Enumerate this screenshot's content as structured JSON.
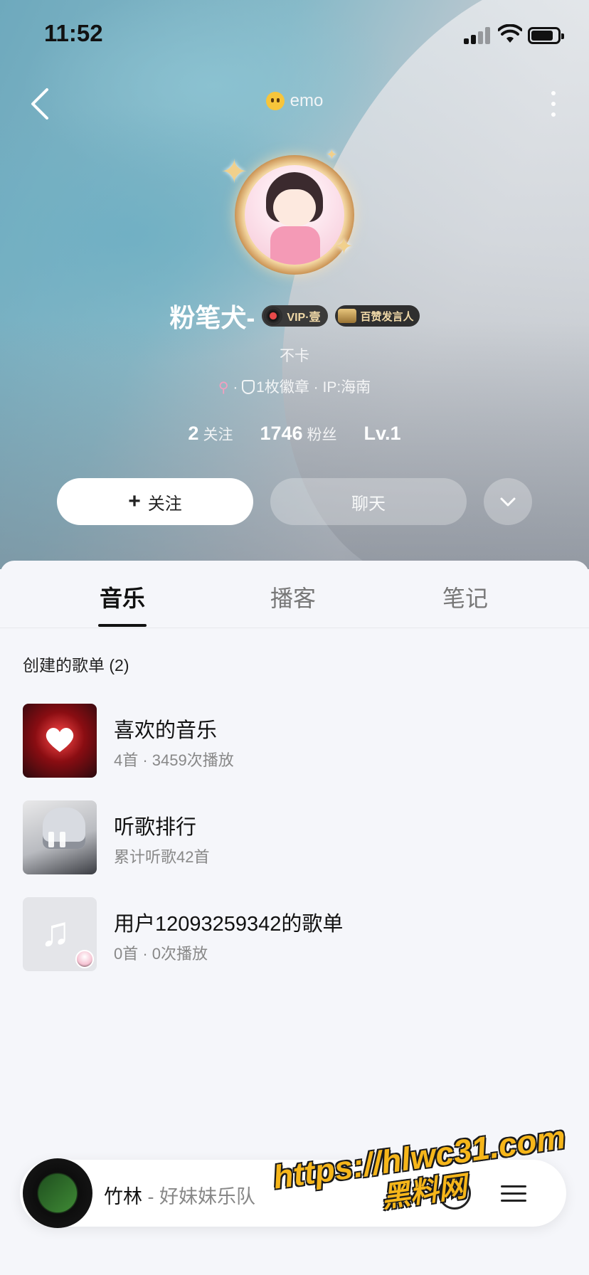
{
  "status_bar": {
    "time": "11:52"
  },
  "header": {
    "mood_text": "emo"
  },
  "profile": {
    "name": "粉笔犬-",
    "vip_badge": "VIP·壹",
    "praise_badge": "百赞发言人",
    "signature": "不卡",
    "medals": "1枚徽章",
    "ip": "IP:海南",
    "stats": [
      {
        "value": "2",
        "label": "关注"
      },
      {
        "value": "1746",
        "label": "粉丝"
      },
      {
        "value": "Lv.1",
        "label": ""
      }
    ]
  },
  "actions": {
    "follow_label": "关注",
    "chat_label": "聊天"
  },
  "tabs": [
    {
      "label": "音乐",
      "active": true
    },
    {
      "label": "播客",
      "active": false
    },
    {
      "label": "笔记",
      "active": false
    }
  ],
  "section": {
    "title": "创建的歌单 (2)"
  },
  "playlists": [
    {
      "title": "喜欢的音乐",
      "subtitle": "4首 · 3459次播放"
    },
    {
      "title": "听歌排行",
      "subtitle": "累计听歌42首"
    },
    {
      "title": "用户12093259342的歌单",
      "subtitle": "0首 · 0次播放"
    }
  ],
  "now_playing": {
    "song": "竹林",
    "separator": " - ",
    "artist": "好妹妹乐队"
  },
  "watermark": {
    "url": "https://hlwc31.com",
    "name": "黑料网"
  },
  "colors": {
    "accent_text": "#111111",
    "muted_text": "#888888",
    "watermark": "#f6b61a"
  },
  "icons": [
    "back-arrow-icon",
    "emo-face-icon",
    "more-vertical-icon",
    "vinyl-icon",
    "mic-icon",
    "gender-icon",
    "medal-icon",
    "plus-icon",
    "chevron-down-icon",
    "heart-icon",
    "pause-icon",
    "music-note-icon",
    "play-icon",
    "playlist-icon"
  ]
}
